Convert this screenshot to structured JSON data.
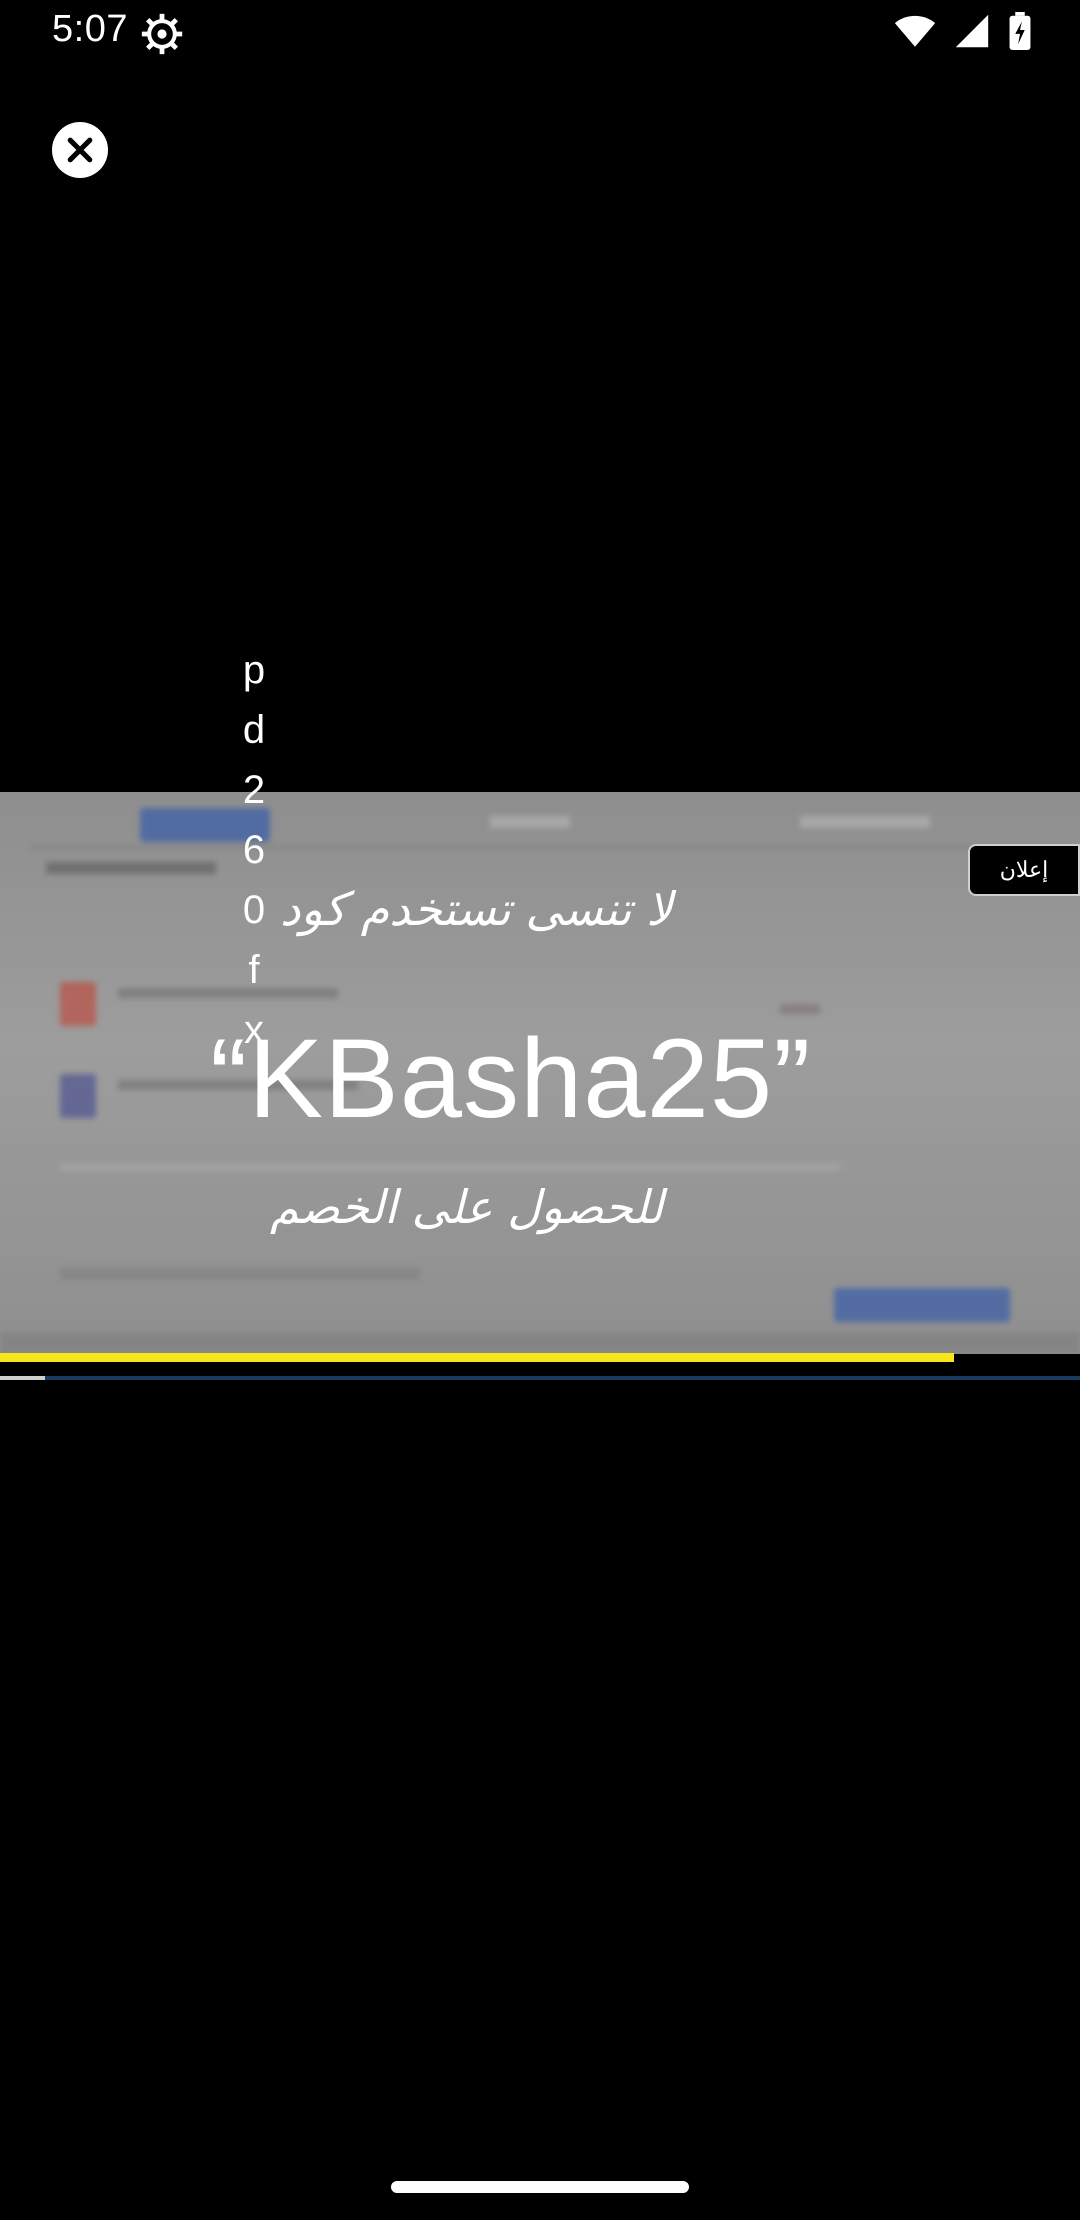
{
  "status": {
    "time": "5:07",
    "icons": [
      "gear-icon",
      "wifi-icon",
      "signal-icon",
      "battery-charging-icon"
    ]
  },
  "controls": {
    "close_icon": "close-icon"
  },
  "ad": {
    "badge": "إعلان",
    "line1": "لا تنسى تستخدم كود",
    "code": "“KBasha25”",
    "line3": "للحصول على الخصم",
    "vertical_text": "p d 2 6 0 f x"
  },
  "progress": {
    "ad_fraction": 0.883,
    "playback_fraction": 0.042
  }
}
